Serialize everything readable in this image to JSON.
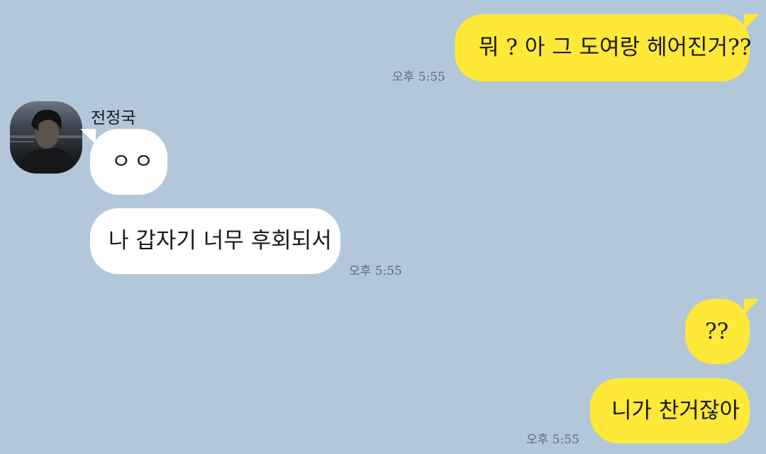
{
  "chat": {
    "contact_name": "전정국",
    "messages": [
      {
        "id": "m1",
        "side": "mine",
        "text": "뭐 ? 아 그 도여랑 헤어진거??",
        "time": "오후 5:55"
      },
      {
        "id": "m2",
        "side": "theirs",
        "text": "ㅇㅇ"
      },
      {
        "id": "m3",
        "side": "theirs",
        "text": "나 갑자기 너무 후회되서",
        "time": "오후 5:55"
      },
      {
        "id": "m4",
        "side": "mine",
        "text": "??"
      },
      {
        "id": "m5",
        "side": "mine",
        "text": "니가 찬거잖아",
        "time": "오후 5:55"
      }
    ]
  },
  "colors": {
    "background": "#b2c7da",
    "my_bubble": "#fee838",
    "their_bubble": "#ffffff",
    "timestamp": "#5b6a78"
  }
}
